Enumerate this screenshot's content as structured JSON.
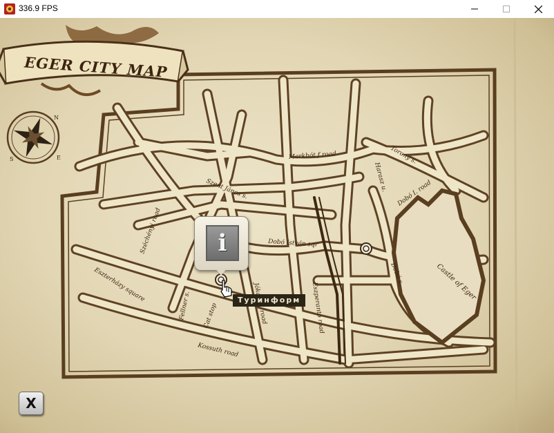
{
  "window": {
    "title": "336.9 FPS",
    "icon": "app-icon",
    "controls": [
      "minimize-icon",
      "maximize-icon",
      "close-icon"
    ]
  },
  "map": {
    "banner_title": "EGER CITY MAP",
    "compass": {
      "north": "N",
      "south": "S",
      "east": "E"
    },
    "labels": {
      "markhot_road": "Markhót f road",
      "torony_road": "Torony s.",
      "haraszt_road": "Harasz u.",
      "dobo_road": "Dobó I. road",
      "szent_janos": "Szent János s.",
      "dobo_istvan_sqr": "Dobó István sqr",
      "szechenyi_road": "Széchényi road",
      "eszterhazy_square": "Eszterházy square",
      "fellner": "Fellner s.",
      "cat_stop": "Cat stop",
      "jokai": "Jókai M. road",
      "eszperanto": "Eszperanto road",
      "kossuth_road": "Kossuth road",
      "dobo_s": "Dobó s.",
      "castle": "Castle of Eger"
    }
  },
  "info_popup": {
    "icon": "info-icon",
    "glyph": "i"
  },
  "tooltip": {
    "text": "Туринформ"
  },
  "close_button": {
    "label": "X"
  },
  "colors": {
    "ink": "#5a3e20",
    "paper": "#e6dcc0",
    "tooltip_bg": "#2b2518"
  }
}
